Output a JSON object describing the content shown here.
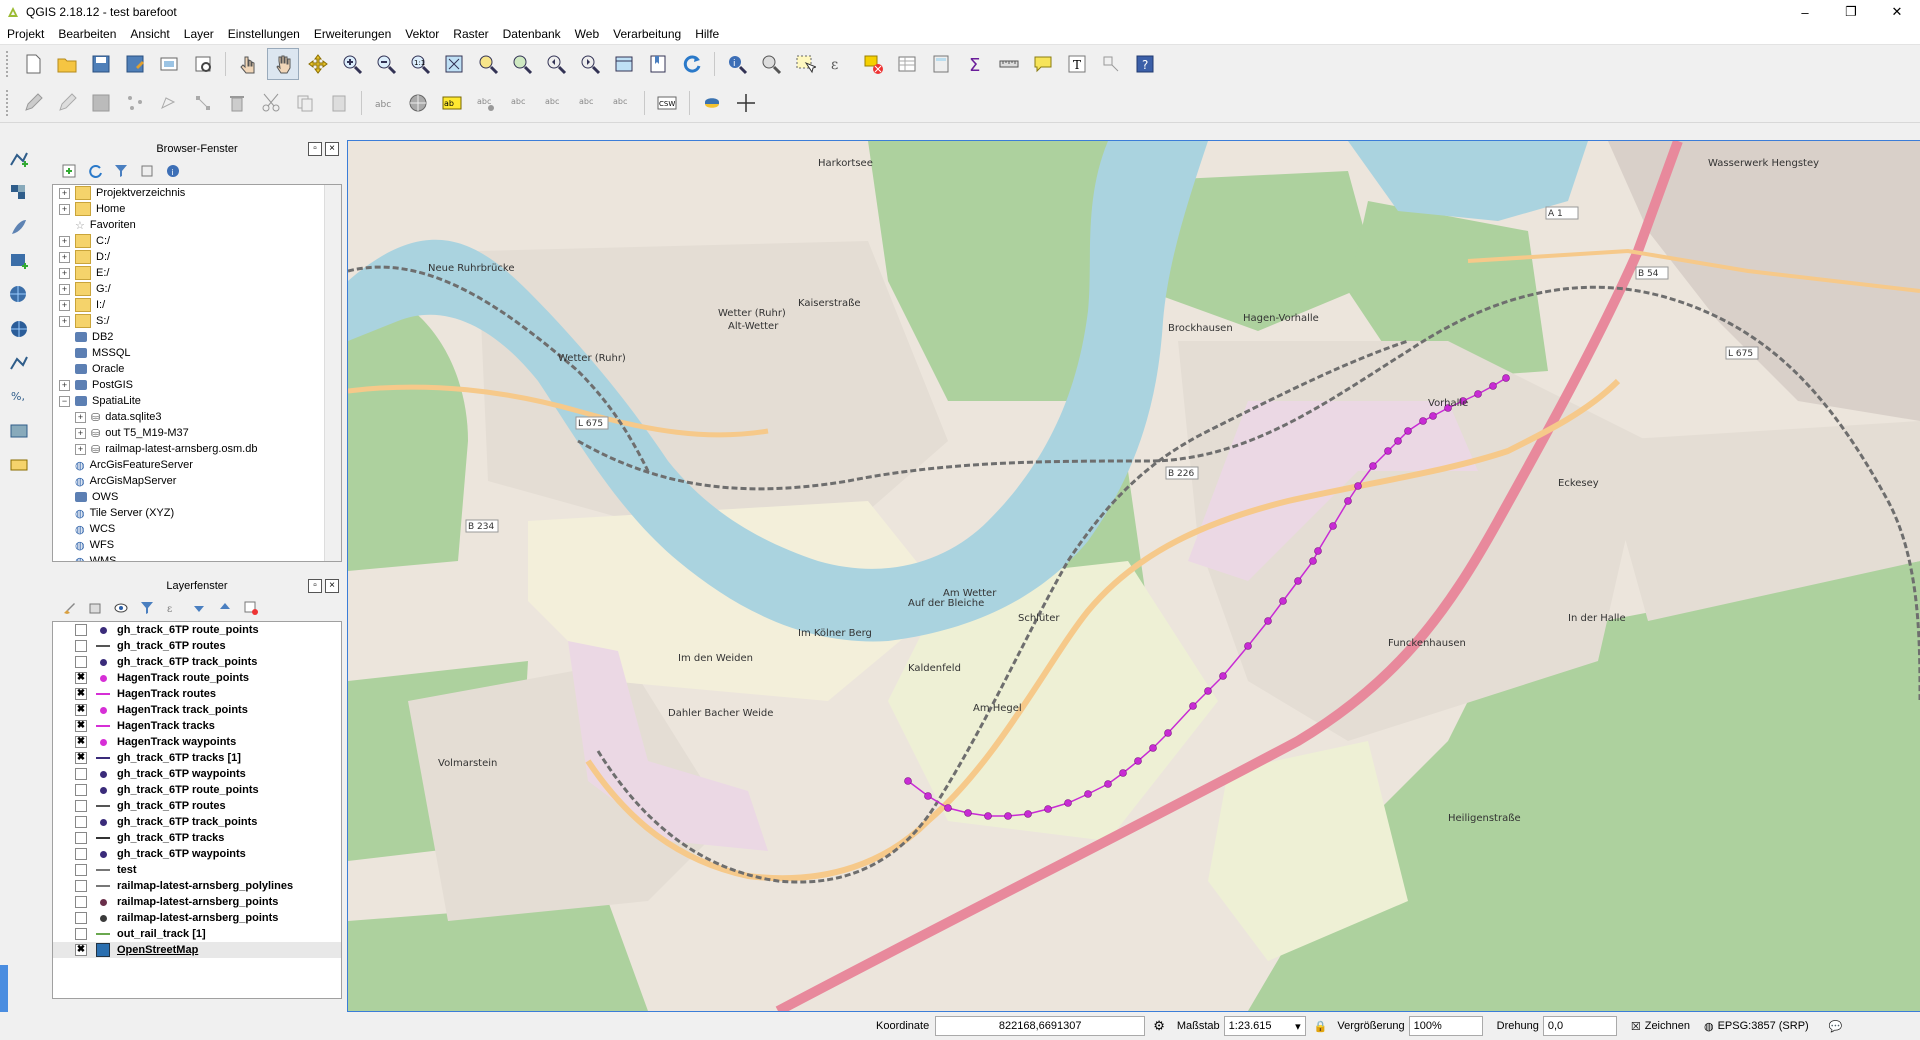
{
  "window": {
    "title": "QGIS 2.18.12 - test barefoot",
    "minimize": "–",
    "maximize": "❐",
    "close": "✕"
  },
  "menu": [
    "Projekt",
    "Bearbeiten",
    "Ansicht",
    "Layer",
    "Einstellungen",
    "Erweiterungen",
    "Vektor",
    "Raster",
    "Datenbank",
    "Web",
    "Verarbeitung",
    "Hilfe"
  ],
  "browser": {
    "title": "Browser-Fenster",
    "items": [
      {
        "label": "Projektverzeichnis",
        "icon": "folder-icon",
        "expander": "+"
      },
      {
        "label": "Home",
        "icon": "folder-icon",
        "expander": "+"
      },
      {
        "label": "Favoriten",
        "icon": "star-icon",
        "expander": ""
      },
      {
        "label": "C:/",
        "icon": "folder-icon",
        "expander": "+"
      },
      {
        "label": "D:/",
        "icon": "folder-icon",
        "expander": "+"
      },
      {
        "label": "E:/",
        "icon": "folder-icon",
        "expander": "+"
      },
      {
        "label": "G:/",
        "icon": "folder-icon",
        "expander": "+"
      },
      {
        "label": "I:/",
        "icon": "folder-icon",
        "expander": "+"
      },
      {
        "label": "S:/",
        "icon": "folder-icon",
        "expander": "+"
      },
      {
        "label": "DB2",
        "icon": "db2-icon",
        "expander": ""
      },
      {
        "label": "MSSQL",
        "icon": "mssql-icon",
        "expander": ""
      },
      {
        "label": "Oracle",
        "icon": "oracle-icon",
        "expander": ""
      },
      {
        "label": "PostGIS",
        "icon": "postgis-icon",
        "expander": "+"
      },
      {
        "label": "SpatiaLite",
        "icon": "spatialite-icon",
        "expander": "−"
      },
      {
        "label": "data.sqlite3",
        "icon": "database-icon",
        "expander": "+",
        "indent": 1
      },
      {
        "label": "out T5_M19-M37",
        "icon": "database-icon",
        "expander": "+",
        "indent": 1
      },
      {
        "label": "railmap-latest-arnsberg.osm.db",
        "icon": "database-icon",
        "expander": "+",
        "indent": 1
      },
      {
        "label": "ArcGisFeatureServer",
        "icon": "globe-icon",
        "expander": ""
      },
      {
        "label": "ArcGisMapServer",
        "icon": "globe-icon",
        "expander": ""
      },
      {
        "label": "OWS",
        "icon": "ows-icon",
        "expander": ""
      },
      {
        "label": "Tile Server (XYZ)",
        "icon": "globe-icon",
        "expander": ""
      },
      {
        "label": "WCS",
        "icon": "globe-icon",
        "expander": ""
      },
      {
        "label": "WFS",
        "icon": "globe-icon",
        "expander": ""
      },
      {
        "label": "WMS",
        "icon": "globe-icon",
        "expander": ""
      }
    ]
  },
  "layers": {
    "title": "Layerfenster",
    "items": [
      {
        "label": "gh_track_6TP route_points",
        "checked": false,
        "symbol": "dot",
        "color": "#3a2b7a"
      },
      {
        "label": "gh_track_6TP routes",
        "checked": false,
        "symbol": "line",
        "color": "#555555"
      },
      {
        "label": "gh_track_6TP track_points",
        "checked": false,
        "symbol": "dot",
        "color": "#3a2b7a"
      },
      {
        "label": "HagenTrack route_points",
        "checked": true,
        "symbol": "dot",
        "color": "#d62fd6"
      },
      {
        "label": "HagenTrack routes",
        "checked": true,
        "symbol": "line",
        "color": "#d62fd6"
      },
      {
        "label": "HagenTrack track_points",
        "checked": true,
        "symbol": "dot",
        "color": "#d62fd6"
      },
      {
        "label": "HagenTrack tracks",
        "checked": true,
        "symbol": "line",
        "color": "#d62fd6"
      },
      {
        "label": "HagenTrack waypoints",
        "checked": true,
        "symbol": "dot",
        "color": "#d62fd6"
      },
      {
        "label": "gh_track_6TP tracks [1]",
        "checked": true,
        "symbol": "line",
        "color": "#3a2b7a"
      },
      {
        "label": "gh_track_6TP waypoints",
        "checked": false,
        "symbol": "dot",
        "color": "#3a2b7a"
      },
      {
        "label": "gh_track_6TP route_points",
        "checked": false,
        "symbol": "dot",
        "color": "#3a2b7a"
      },
      {
        "label": "gh_track_6TP routes",
        "checked": false,
        "symbol": "line",
        "color": "#555555"
      },
      {
        "label": "gh_track_6TP track_points",
        "checked": false,
        "symbol": "dot",
        "color": "#3a2b7a"
      },
      {
        "label": "gh_track_6TP tracks",
        "checked": false,
        "symbol": "line",
        "color": "#333333"
      },
      {
        "label": "gh_track_6TP waypoints",
        "checked": false,
        "symbol": "dot",
        "color": "#3a2b7a"
      },
      {
        "label": "test",
        "checked": false,
        "symbol": "line",
        "color": "#777777"
      },
      {
        "label": "railmap-latest-arnsberg_polylines",
        "checked": false,
        "symbol": "line",
        "color": "#777777"
      },
      {
        "label": "railmap-latest-arnsberg_points",
        "checked": false,
        "symbol": "dot",
        "color": "#6a2f4a"
      },
      {
        "label": "railmap-latest-arnsberg_points",
        "checked": false,
        "symbol": "dot",
        "color": "#3b3b3b"
      },
      {
        "label": "out_rail_track [1]",
        "checked": false,
        "symbol": "line",
        "color": "#6aa84f"
      },
      {
        "label": "OpenStreetMap",
        "checked": true,
        "symbol": "raster",
        "color": "#2a6fb0"
      }
    ]
  },
  "map": {
    "labels": [
      "Harkortsee",
      "Wetter (Ruhr)",
      "Alt-Wetter",
      "Neue Ruhrbrücke",
      "Kaiserstraße",
      "Wetter (Ruhr)",
      "Vorhalle",
      "Hagen-Vorhalle",
      "Brockhausen",
      "Volmarstein",
      "Am Hegel",
      "Eckesey",
      "Funckenhausen",
      "In der Halle",
      "Heiligenstraße",
      "Dahler Bacher Weide",
      "Am Wetter",
      "Kaldenfeld",
      "Im Kölner Berg",
      "Schlüter",
      "Auf der Bleiche",
      "Wasserwerk Hengstey",
      "Im den Weiden"
    ],
    "roads": [
      "B 226",
      "L 675",
      "B 234",
      "A 1",
      "B 54",
      "L 675"
    ],
    "colors": {
      "track": "#c82bd4",
      "motorway": "#e8899c",
      "primary": "#f6c98a",
      "water": "#aad3df",
      "forest": "#add19e",
      "urban": "#e6e0d8",
      "rail": "#6e6e6e"
    }
  },
  "statusbar": {
    "coord_label": "Koordinate",
    "coord_value": "822168,6691307",
    "scale_label": "Maßstab",
    "scale_value": "1:23.615",
    "mag_label": "Vergrößerung",
    "mag_value": "100%",
    "rot_label": "Drehung",
    "rot_value": "0,0",
    "render_label": "Zeichnen",
    "crs_label": "EPSG:3857 (SRP)"
  }
}
